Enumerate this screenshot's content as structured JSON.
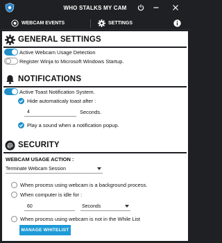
{
  "app": {
    "title": "WHO STALKS MY CAM"
  },
  "tabs": [
    {
      "label": "WEBCAM EVENTS",
      "icon": "camera-icon"
    },
    {
      "label": "SETTINGS",
      "icon": "gear-icon"
    }
  ],
  "sections": {
    "general": {
      "title": "GENERAL SETTINGS",
      "items": [
        {
          "label": "Active Webcam Usage Detection",
          "state": "on"
        },
        {
          "label": "Register Winja to Microsoft Windows Startup.",
          "state": "off"
        }
      ]
    },
    "notifications": {
      "title": "NOTIFICATIONS",
      "toggle_label": "Active Toast Notification System.",
      "hide_label": "Hide automaticaly toast after :",
      "seconds_value": "4",
      "seconds_label": "Seconds.",
      "sound_label": "Play a sound when a notification popup."
    },
    "security": {
      "title": "SECURITY",
      "usage_action_label": "WEBCAM USAGE ACTION :",
      "usage_action_value": "Terminate Webcam Session",
      "options": [
        "When process using webcam is a background process.",
        "When computer is idle for :",
        "When process using webcam is not in the While List"
      ],
      "idle_value": "60",
      "idle_unit": "Seconds",
      "whitelist_button": "MANAGE WHITELIST"
    }
  },
  "colors": {
    "accent": "#1e8fc8",
    "chrome": "#1f2023"
  }
}
